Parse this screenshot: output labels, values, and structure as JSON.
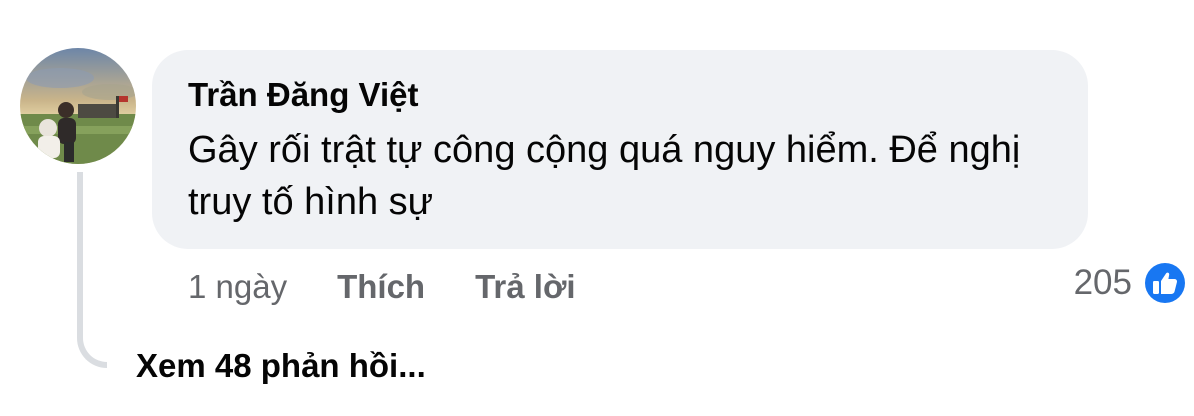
{
  "comment": {
    "author": "Trần Đăng Việt",
    "text": "Gây rối trật tự công cộng quá nguy hiểm. Để nghị truy tố hình sự",
    "timestamp": "1 ngày",
    "like_label": "Thích",
    "reply_label": "Trả lời",
    "reaction_count": "205",
    "reaction_icon": "like-icon",
    "view_replies_label": "Xem 48 phản hồi..."
  },
  "colors": {
    "bubble_bg": "#f0f2f5",
    "secondary_text": "#65676b",
    "like_blue": "#1877f2",
    "thread_line": "#dadde1"
  }
}
